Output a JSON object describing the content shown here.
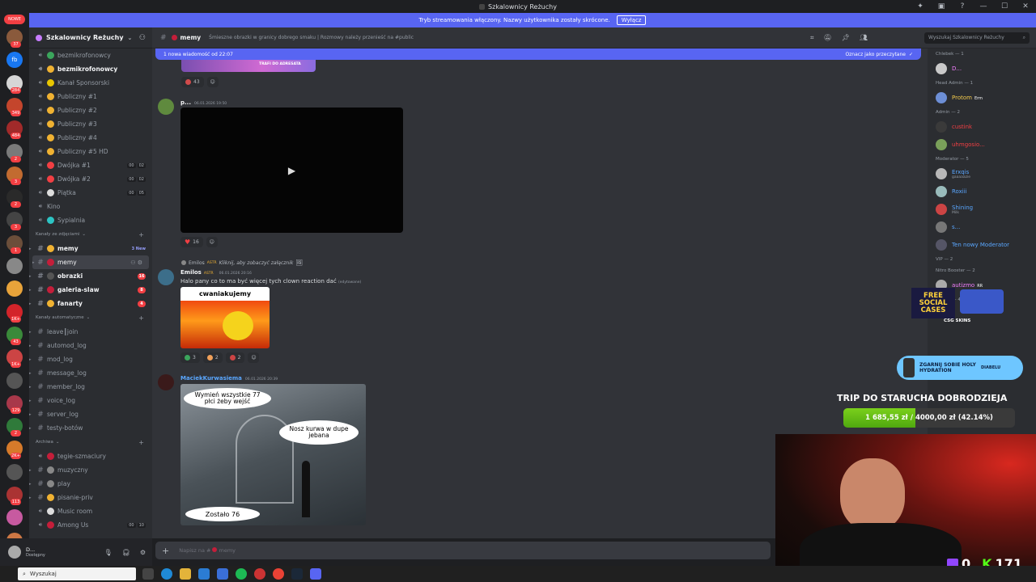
{
  "window": {
    "title": "Szkalownicy Reżuchy"
  },
  "banner": {
    "text": "Tryb streamowania włączony. Nazwy użytkownika zostały skrócone.",
    "button": "Wyłącz"
  },
  "rail": {
    "new_badge": "NOWE",
    "servers": [
      {
        "badge": "37",
        "color": "#8a5a3c"
      },
      {
        "badge": "",
        "color": "#1877f2",
        "label": "fb"
      },
      {
        "badge": "284",
        "color": "#d6d6d6"
      },
      {
        "badge": "349",
        "color": "#c4452c"
      },
      {
        "badge": "484",
        "color": "#a12a2a"
      },
      {
        "badge": "2",
        "color": "#7a7a7a"
      },
      {
        "badge": "3",
        "color": "#c26b30"
      },
      {
        "badge": "2",
        "color": "#2a2a2a"
      },
      {
        "badge": "3",
        "color": "#444"
      },
      {
        "badge": "1",
        "color": "#6b4e3a"
      },
      {
        "badge": "",
        "color": "#888"
      },
      {
        "badge": "",
        "color": "#e8a33a"
      },
      {
        "badge": "1K+",
        "color": "#d3242a"
      },
      {
        "badge": "43",
        "color": "#3a8a3a"
      },
      {
        "badge": "1K+",
        "color": "#c44"
      },
      {
        "badge": "",
        "color": "#555"
      },
      {
        "badge": "129",
        "color": "#a8384a"
      },
      {
        "badge": "2",
        "color": "#2f7a3a"
      },
      {
        "badge": "2K+",
        "color": "#d67a2a"
      },
      {
        "badge": "",
        "color": "#555"
      },
      {
        "badge": "113",
        "color": "#a33"
      },
      {
        "badge": "",
        "color": "#c75aa0"
      },
      {
        "badge": "725",
        "color": "#c74"
      }
    ]
  },
  "guild": {
    "name": "Szkalownicy Reżuchy"
  },
  "channels": [
    {
      "type": "voice",
      "label": "bezmikrofonowcy",
      "emoji": "#3ba55c"
    },
    {
      "type": "voice",
      "label": "bezmikrofonowcy",
      "emoji": "#f0b232",
      "unread": true
    },
    {
      "type": "voice",
      "label": "Kanał Sponsorski",
      "emoji": "#e8c600"
    },
    {
      "type": "voice",
      "label": "Publiczny #1",
      "emoji": "#f0b232"
    },
    {
      "type": "voice",
      "label": "Publiczny #2",
      "emoji": "#f0b232"
    },
    {
      "type": "voice",
      "label": "Publiczny #3",
      "emoji": "#f0b232"
    },
    {
      "type": "voice",
      "label": "Publiczny #4",
      "emoji": "#f0b232"
    },
    {
      "type": "voice",
      "label": "Publiczny #5 HD",
      "emoji": "#f0b232"
    },
    {
      "type": "voice",
      "label": "Dwójka #1",
      "emoji": "#f23f43",
      "counts": [
        "00",
        "02"
      ]
    },
    {
      "type": "voice",
      "label": "Dwójka #2",
      "emoji": "#f23f43",
      "counts": [
        "00",
        "02"
      ]
    },
    {
      "type": "voice",
      "label": "Piątka",
      "emoji": "#dddddd",
      "counts": [
        "00",
        "05"
      ]
    },
    {
      "type": "voice",
      "label": "Kino",
      "emoji": ""
    },
    {
      "type": "voice",
      "label": "Sypialnia",
      "emoji": "#2dc4c4"
    }
  ],
  "cat_images": {
    "label": "Kanały ze zdjęciami"
  },
  "image_channels": [
    {
      "label": "memy",
      "emoji": "#f0b232",
      "right": "3 New",
      "rtype": "new",
      "unread": true
    },
    {
      "label": "memy",
      "emoji": "#c41e3a",
      "active": true
    },
    {
      "label": "obrazki",
      "emoji": "#555",
      "right": "16",
      "rtype": "badge",
      "unread": true
    },
    {
      "label": "galeria-slaw",
      "emoji": "#c41e3a",
      "right": "8",
      "rtype": "badge",
      "unread": true
    },
    {
      "label": "fanarty",
      "emoji": "#f0b232",
      "right": "4",
      "rtype": "badge",
      "unread": true
    }
  ],
  "cat_auto": {
    "label": "Kanały automatyczne"
  },
  "auto_channels": [
    {
      "label": "leave┃join"
    },
    {
      "label": "automod_log"
    },
    {
      "label": "mod_log"
    },
    {
      "label": "message_log"
    },
    {
      "label": "member_log"
    },
    {
      "label": "voice_log"
    },
    {
      "label": "server_log"
    },
    {
      "label": "testy-botów"
    }
  ],
  "cat_archive": {
    "label": "Archiwa"
  },
  "archive_channels": [
    {
      "label": "tegie-szmaciury",
      "type": "voice",
      "emoji": "#c41e3a"
    },
    {
      "label": "muzyczny",
      "type": "text",
      "emoji": "#888"
    },
    {
      "label": "play",
      "type": "text",
      "emoji": "#888"
    },
    {
      "label": "pisanie-priv",
      "type": "text",
      "emoji": "#f0b232"
    },
    {
      "label": "Music room",
      "type": "voice",
      "emoji": "#ddd"
    },
    {
      "label": "Among Us",
      "type": "voice",
      "emoji": "#c41e3a",
      "counts": [
        "00",
        "10"
      ]
    }
  ],
  "user": {
    "name": "D...",
    "status": "Dostępny"
  },
  "chat": {
    "channel": "memy",
    "topic": "Śmieszne obrazki w granicy dobrego smaku | Rozmowy należy przenieść na #public",
    "search_placeholder": "Wyszukaj Szkalownicy Reżuchy",
    "new_messages": "1 nowa wiadomość od 22:07",
    "mark_read": "Oznacz jako przeczytane",
    "top_image_caption": "TRAFI DO ADRESATA",
    "top_reaction_count": "43",
    "msg1": {
      "author": "p...",
      "time": "06.01.2026 19:50",
      "reaction_count": "16"
    },
    "reply": {
      "author": "Emilos",
      "tag": "ASTR",
      "text": "Kliknij, aby zobaczyć załącznik"
    },
    "msg2": {
      "author": "Emilos",
      "tag": "ASTR",
      "time": "06.01.2026 20:16",
      "text": "Halo pany co to ma być więcej tych clown reaction dać",
      "edited": "(edytowane)",
      "image_title": "cwaniakujemy",
      "reactions": [
        "3",
        "2",
        "2"
      ]
    },
    "msg3": {
      "author": "MaciekKurwasiema",
      "time": "06.01.2026 20:39",
      "bubble1": "Wymień wszystkie 77 płci żeby wejść",
      "bubble2": "Nosz kurwa w dupe jebana",
      "bubble3": "Zostało 76"
    },
    "composer_placeholder": "Napisz na #",
    "composer_channel": "memy"
  },
  "members": {
    "groups": [
      {
        "title": "Chlebek — 1",
        "items": [
          {
            "name": "D...",
            "color": "#f47fff"
          }
        ]
      },
      {
        "title": "Head Admin — 1",
        "items": [
          {
            "name": "Protom",
            "color": "#f2c94c",
            "extra": "Erm"
          }
        ]
      },
      {
        "title": "Admin — 2",
        "items": [
          {
            "name": "custink",
            "color": "#f23f43"
          },
          {
            "name": "uhmgosio...",
            "color": "#f23f43"
          }
        ]
      },
      {
        "title": "Moderator — 5",
        "items": [
          {
            "name": "Erxqis",
            "color": "#5aa7ff",
            "sub": "gaaaaazie"
          },
          {
            "name": "Roxiii",
            "color": "#5aa7ff"
          },
          {
            "name": "Shining",
            "color": "#5aa7ff",
            "sub": "Milk"
          },
          {
            "name": "s...",
            "color": "#5aa7ff"
          },
          {
            "name": "Ten nowy Moderator",
            "color": "#5aa7ff"
          }
        ]
      },
      {
        "title": "VIP — 2",
        "items": []
      },
      {
        "title": "Nitro Booster — 2",
        "items": [
          {
            "name": "autizmo",
            "color": "#f47fff",
            "extra": "RR"
          }
        ]
      },
      {
        "title": "Prałaci — 4",
        "items": []
      }
    ]
  },
  "overlay": {
    "title": "TRIP DO STARUCHA DOBRODZIEJA",
    "raised": "1 685,55 zł",
    "separator": "/",
    "goal": "4000,00 zł",
    "percent_label": "(42.14%)",
    "fraction": 0.4214,
    "promo_text": "FREE SOCIAL CASES",
    "promo_brand": "CSG SKINS",
    "promo2_text": "ZGARNIJ SOBIE HOLY HYDRATION",
    "promo2_sub": "DIABELU",
    "counter_twitch": "0",
    "counter_kick": "171"
  },
  "taskbar": {
    "search_placeholder": "Wyszukaj"
  }
}
